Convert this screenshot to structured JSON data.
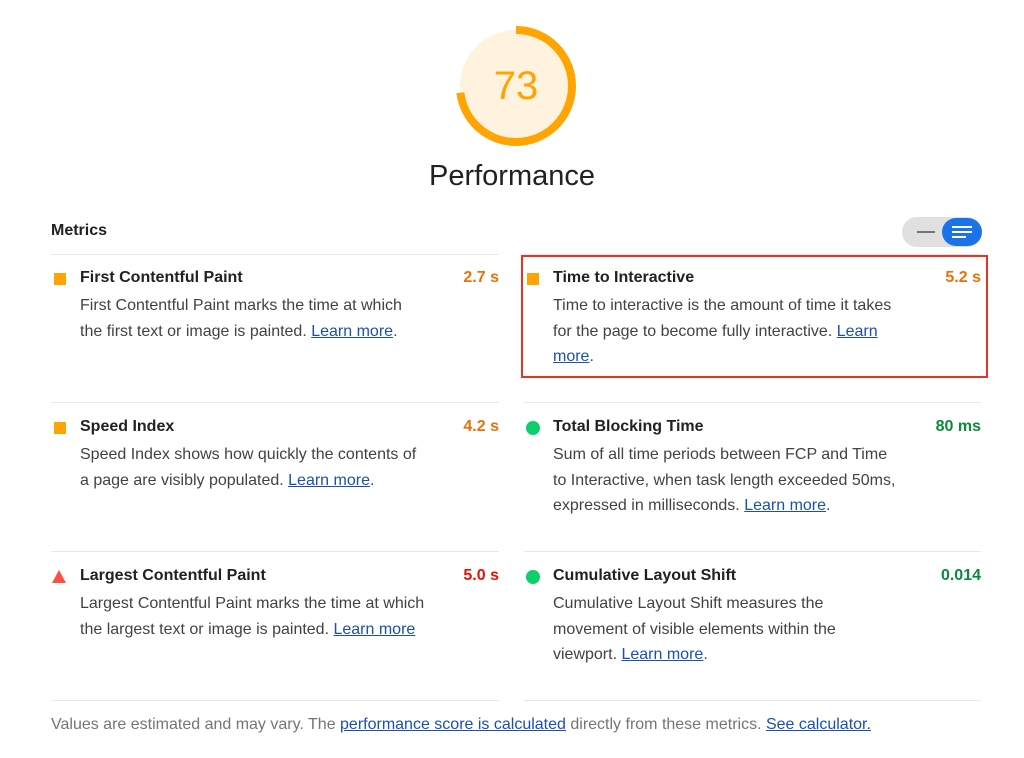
{
  "score": {
    "value": "73",
    "fraction": 0.73,
    "rating": "average",
    "color": "#ffa400",
    "track_color": "#fff3e0"
  },
  "category": {
    "title": "Performance"
  },
  "metrics_section": {
    "header": "Metrics",
    "toggle": {
      "compact_icon": "lines-compact-icon",
      "expanded_icon": "lines-expanded-icon",
      "selected": "expanded"
    }
  },
  "metrics": [
    {
      "title": "First Contentful Paint",
      "value": "2.7 s",
      "rating": "average",
      "icon": "orange-square-icon",
      "description": "First Contentful Paint marks the time at which the first text or image is painted.",
      "link": "Learn more"
    },
    {
      "title": "Time to Interactive",
      "value": "5.2 s",
      "rating": "average",
      "icon": "orange-square-icon",
      "description": "Time to interactive is the amount of time it takes for the page to become fully interactive.",
      "link": "Learn more"
    },
    {
      "title": "Speed Index",
      "value": "4.2 s",
      "rating": "average",
      "icon": "orange-square-icon",
      "description": "Speed Index shows how quickly the contents of a page are visibly populated.",
      "link": "Learn more"
    },
    {
      "title": "Total Blocking Time",
      "value": "80 ms",
      "rating": "pass",
      "icon": "green-circle-icon",
      "description": "Sum of all time periods between FCP and Time to Interactive, when task length exceeded 50ms, expressed in milliseconds.",
      "link": "Learn more"
    },
    {
      "title": "Largest Contentful Paint",
      "value": "5.0 s",
      "rating": "fail",
      "icon": "red-triangle-icon",
      "description": "Largest Contentful Paint marks the time at which the largest text or image is painted.",
      "link": "Learn more"
    },
    {
      "title": "Cumulative Layout Shift",
      "value": "0.014",
      "rating": "pass",
      "icon": "green-circle-icon",
      "description": "Cumulative Layout Shift measures the movement of visible elements within the viewport.",
      "link": "Learn more"
    }
  ],
  "footer": {
    "text_before": "Values are estimated and may vary. The ",
    "link1": "performance score is calculated",
    "text_middle": " directly from these metrics. ",
    "link2": "See calculator."
  },
  "colors": {
    "average": "#ffa400",
    "fail": "#ff4e42",
    "pass": "#0cce6b",
    "highlight_box": "#e53425",
    "link": "#1a4fb5"
  }
}
